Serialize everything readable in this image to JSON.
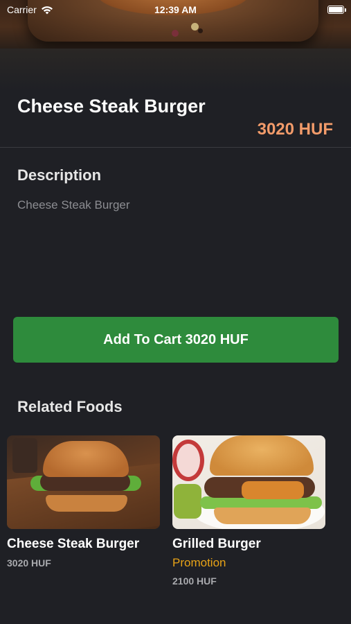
{
  "status_bar": {
    "carrier": "Carrier",
    "time": "12:39 AM"
  },
  "product": {
    "title": "Cheese Steak Burger",
    "price": "3020 HUF"
  },
  "description": {
    "heading": "Description",
    "text": "Cheese Steak Burger"
  },
  "cart_button": {
    "label": "Add To Cart 3020 HUF"
  },
  "related": {
    "heading": "Related Foods",
    "items": [
      {
        "name": "Cheese Steak Burger",
        "promotion": "",
        "price": "3020 HUF"
      },
      {
        "name": "Grilled Burger",
        "promotion": "Promotion",
        "price": "2100 HUF"
      }
    ]
  },
  "colors": {
    "background": "#1f2025",
    "price_accent": "#f29b6a",
    "button": "#2e8b3c",
    "promotion": "#e8a317"
  },
  "icons": [
    "wifi-icon",
    "battery-icon"
  ]
}
